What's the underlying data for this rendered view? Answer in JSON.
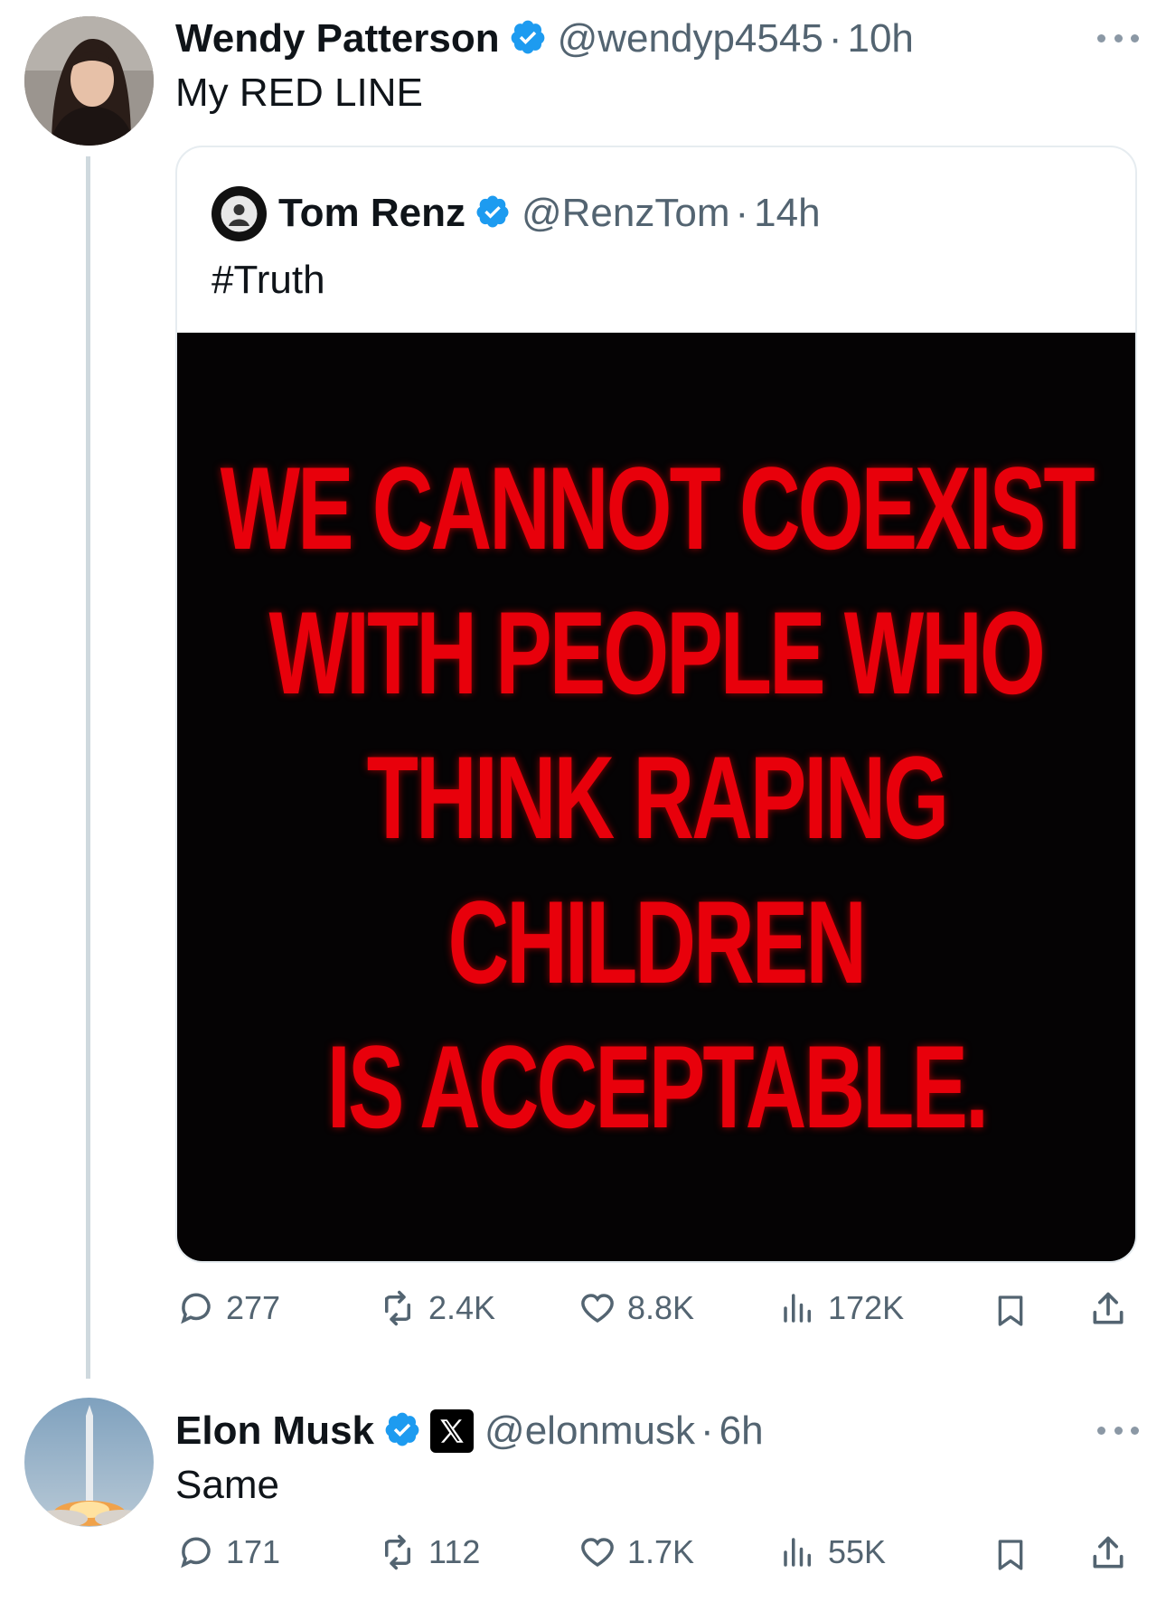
{
  "tweet1": {
    "name": "Wendy Patterson",
    "handle": "@wendyp4545",
    "time_sep": "·",
    "time": "10h",
    "text": "My RED LINE",
    "quote": {
      "name": "Tom Renz",
      "handle": "@RenzTom",
      "time_sep": "·",
      "time": "14h",
      "text": "#Truth",
      "image_lines": [
        "WE CANNOT COEXIST",
        "WITH PEOPLE WHO",
        "THINK RAPING",
        "CHILDREN",
        "IS ACCEPTABLE."
      ]
    },
    "actions": {
      "replies": "277",
      "reposts": "2.4K",
      "likes": "8.8K",
      "views": "172K"
    }
  },
  "tweet2": {
    "name": "Elon Musk",
    "handle": "@elonmusk",
    "time_sep": "·",
    "time": "6h",
    "text": "Same",
    "actions": {
      "replies": "171",
      "reposts": "112",
      "likes": "1.7K",
      "views": "55K"
    }
  },
  "colors": {
    "verified": "#1d9bf0",
    "muted": "#536471",
    "text": "#0f1419",
    "image_text": "#e8000b",
    "image_bg": "#050304"
  },
  "icons": [
    "verified-badge-icon",
    "more-icon",
    "reply-icon",
    "repost-icon",
    "like-icon",
    "views-icon",
    "bookmark-icon",
    "share-icon",
    "x-logo-icon"
  ]
}
